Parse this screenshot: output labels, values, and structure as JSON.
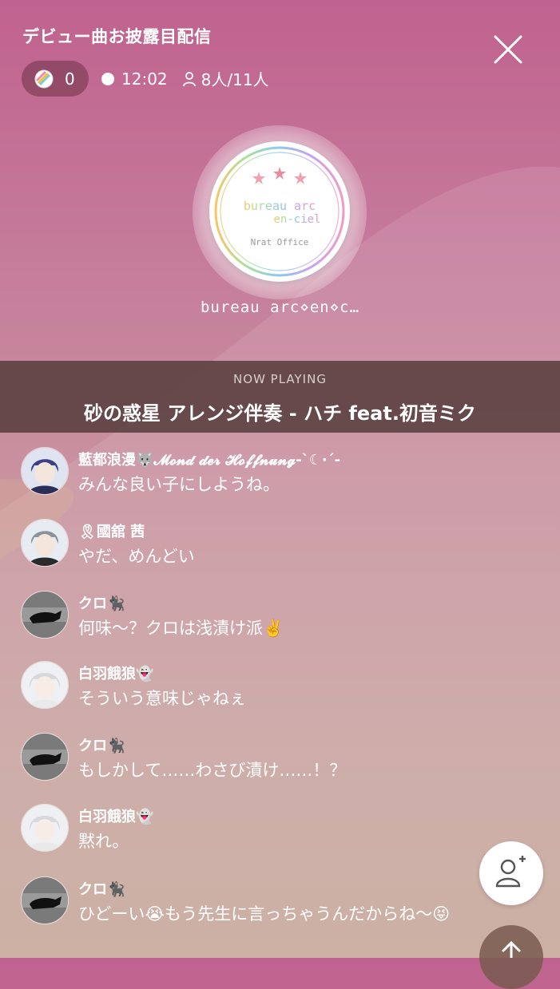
{
  "header": {
    "title": "デビュー曲お披露目配信",
    "coins": "0",
    "time": "12:02",
    "listeners": "8人/11人"
  },
  "room": {
    "name": "bureau arc⋄en⋄c…",
    "logo_text_1": "bureau arc",
    "logo_text_2": "en-ciel",
    "logo_text_3": "Nrat Office"
  },
  "now_playing": {
    "label": "NOW PLAYING",
    "track": "砂の惑星 アレンジ伴奏 - ハチ feat.初音ミク"
  },
  "messages": [
    {
      "name": "藍都浪漫🐺𝓜𝓸𝓷𝓭 𝓭𝓮𝓻 𝓗𝓸𝓯𝓯𝓷𝓾𝓷𝓰-ˋ☾·ˊ-",
      "text": "みんな良い子にしようね。"
    },
    {
      "name": "🎗國舘 茜",
      "text": "やだ、めんどい"
    },
    {
      "name": "クロ🐈‍⬛",
      "text": "何味〜？クロは浅漬け派✌️"
    },
    {
      "name": "白羽餓狼👻",
      "text": "そういう意味じゃねぇ"
    },
    {
      "name": "クロ🐈‍⬛",
      "text": "もしかして……わさび漬け……！？"
    },
    {
      "name": "白羽餓狼👻",
      "text": "黙れ。"
    },
    {
      "name": "クロ🐈‍⬛",
      "text": "ひどーい😭もう先生に言っちゃうんだからね〜😝"
    }
  ],
  "colors": {
    "bg_top": "#c0628f",
    "bg_bottom": "#c7a99a",
    "now_playing_bg": "#553c3c"
  },
  "icons": {
    "close": "close-icon",
    "coin": "coin-icon",
    "person": "person-icon",
    "follow": "add-user-icon",
    "share": "share-icon"
  }
}
